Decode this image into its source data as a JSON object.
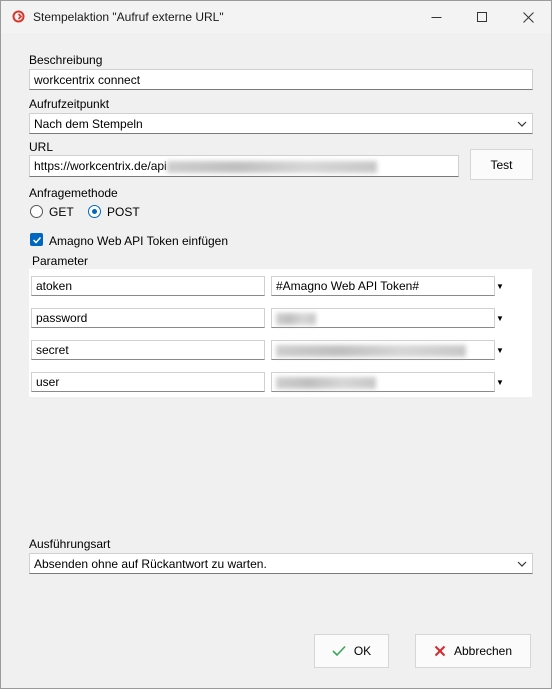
{
  "window": {
    "title": "Stempelaktion \"Aufruf externe URL\"",
    "app_icon": "amagno-logo-icon",
    "controls": [
      "minimize-icon",
      "maximize-icon",
      "close-icon"
    ]
  },
  "beschreibung": {
    "label": "Beschreibung",
    "value": "workcentrix connect"
  },
  "aufrufzeitpunkt": {
    "label": "Aufrufzeitpunkt",
    "value": "Nach dem Stempeln"
  },
  "url": {
    "label": "URL",
    "value": "https://workcentrix.de/api",
    "test_button": "Test"
  },
  "anfragemethode": {
    "label": "Anfragemethode",
    "options": [
      {
        "label": "GET",
        "selected": false
      },
      {
        "label": "POST",
        "selected": true
      }
    ]
  },
  "token_checkbox": {
    "label": "Amagno Web API Token einfügen",
    "checked": true
  },
  "parameter": {
    "label": "Parameter",
    "rows": [
      {
        "name": "atoken",
        "value": "#Amagno Web API Token#"
      },
      {
        "name": "password",
        "value": ""
      },
      {
        "name": "secret",
        "value": ""
      },
      {
        "name": "user",
        "value": ""
      }
    ]
  },
  "ausfuehrungsart": {
    "label": "Ausführungsart",
    "value": "Absenden ohne auf Rückantwort zu warten."
  },
  "footer": {
    "ok_label": "OK",
    "cancel_label": "Abbrechen"
  },
  "colors": {
    "accent": "#0067c0",
    "ok_check": "#3aa657",
    "cancel_x": "#d9272e",
    "app_icon": "#d9362b"
  }
}
